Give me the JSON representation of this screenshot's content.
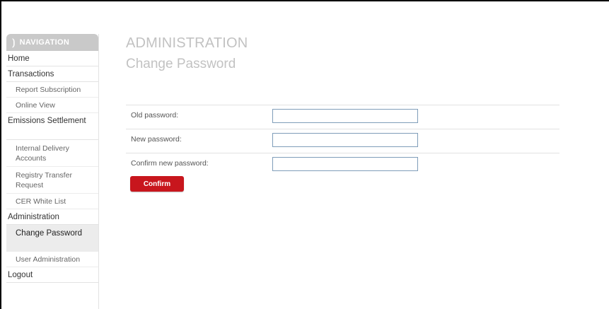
{
  "nav": {
    "header": "NAVIGATION",
    "items": [
      {
        "label": "Home",
        "level": "top"
      },
      {
        "label": "Transactions",
        "level": "top"
      },
      {
        "label": "Report Subscription",
        "level": "sub"
      },
      {
        "label": "Online View",
        "level": "sub"
      },
      {
        "label": "Emissions Settlement",
        "level": "top"
      },
      {
        "label": "Internal Delivery Accounts",
        "level": "sub"
      },
      {
        "label": "Registry Transfer Request",
        "level": "sub"
      },
      {
        "label": "CER White List",
        "level": "sub"
      },
      {
        "label": "Administration",
        "level": "top"
      },
      {
        "label": "Change Password",
        "level": "sub",
        "active": true
      },
      {
        "label": "User Administration",
        "level": "sub"
      },
      {
        "label": "Logout",
        "level": "top"
      }
    ]
  },
  "page": {
    "section": "ADMINISTRATION",
    "title": "Change Password"
  },
  "form": {
    "old_label": "Old password:",
    "old_value": "",
    "new_label": "New password:",
    "new_value": "",
    "confirm_label": "Confirm new password:",
    "confirm_value": "",
    "submit_label": "Confirm"
  },
  "colors": {
    "accent": "#c8161d",
    "nav_header": "#c9c9c9",
    "title": "#c2c2c2"
  }
}
